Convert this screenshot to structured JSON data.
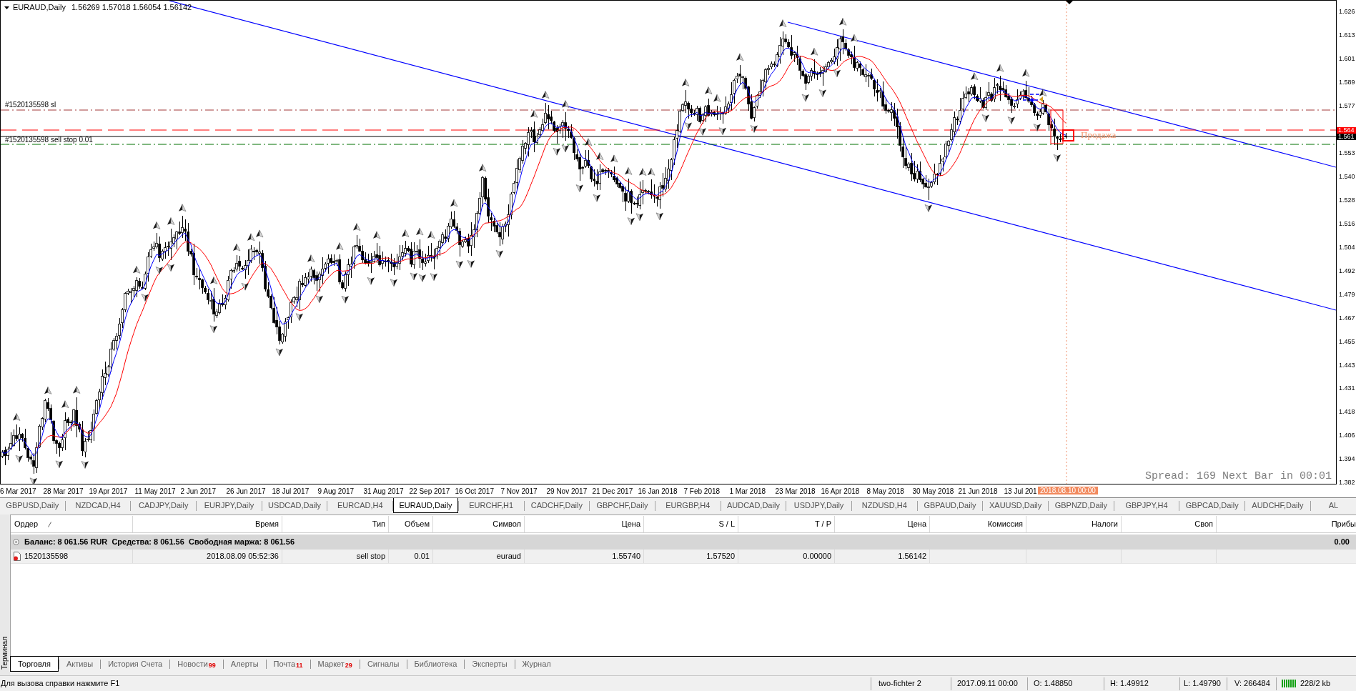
{
  "chart": {
    "header": {
      "symbol": "EURAUD,Daily",
      "ohlc": "1.56269 1.57018 1.56054 1.56142"
    },
    "stop_loss_label": "#1520135598 sl",
    "order_label": "#1520135598 sell stop 0.01",
    "signal_label": "Продажа",
    "info": "Spread: 169 Next Bar in 00:01",
    "price_axis": {
      "upper_labels": [
        "1.626",
        "1.613",
        "1.601",
        "1.589",
        "1.577"
      ],
      "markers": [
        {
          "text": "1.564",
          "color": "#ff0000"
        },
        {
          "text": "1.561",
          "color": "#000000"
        }
      ],
      "lower_labels": [
        "1.553",
        "1.540",
        "1.528",
        "1.516",
        "1.504",
        "1.492",
        "1.479",
        "1.467",
        "1.455",
        "1.443",
        "1.431",
        "1.418",
        "1.406",
        "1.394",
        "1.382"
      ]
    },
    "time_axis": {
      "labels": [
        "6 Mar 2017",
        "28 Mar 2017",
        "19 Apr 2017",
        "11 May 2017",
        "2 Jun 2017",
        "26 Jun 2017",
        "18 Jul 2017",
        "9 Aug 2017",
        "31 Aug 2017",
        "22 Sep 2017",
        "16 Oct 2017",
        "7 Nov 2017",
        "29 Nov 2017",
        "21 Dec 2017",
        "16 Jan 2018",
        "7 Feb 2018",
        "1 Mar 2018",
        "23 Mar 2018",
        "16 Apr 2018",
        "8 May 2018",
        "30 May 2018",
        "21 Jun 2018",
        "13 Jul 201"
      ],
      "cursor_label": "2018.08.10 00:00"
    }
  },
  "chart_tabs": [
    {
      "label": "GBPUSD,Daily",
      "selected": false
    },
    {
      "label": "NZDCAD,H4",
      "selected": false
    },
    {
      "label": "CADJPY,Daily",
      "selected": false
    },
    {
      "label": "EURJPY,Daily",
      "selected": false
    },
    {
      "label": "USDCAD,Daily",
      "selected": false
    },
    {
      "label": "EURCAD,H4",
      "selected": false
    },
    {
      "label": "EURAUD,Daily",
      "selected": true
    },
    {
      "label": "EURCHF,H1",
      "selected": false
    },
    {
      "label": "CADCHF,Daily",
      "selected": false
    },
    {
      "label": "GBPCHF,Daily",
      "selected": false
    },
    {
      "label": "EURGBP,H4",
      "selected": false
    },
    {
      "label": "AUDCAD,Daily",
      "selected": false
    },
    {
      "label": "USDJPY,Daily",
      "selected": false
    },
    {
      "label": "NZDUSD,H4",
      "selected": false
    },
    {
      "label": "GBPAUD,Daily",
      "selected": false
    },
    {
      "label": "XAUUSD,Daily",
      "selected": false
    },
    {
      "label": "GBPNZD,Daily",
      "selected": false
    },
    {
      "label": "GBPJPY,H4",
      "selected": false
    },
    {
      "label": "GBPCAD,Daily",
      "selected": false
    },
    {
      "label": "AUDCHF,Daily",
      "selected": false
    },
    {
      "label": "AL",
      "selected": false
    }
  ],
  "terminal": {
    "side_label": "Терминал",
    "columns": [
      "Ордер",
      "Время",
      "Тип",
      "Объем",
      "Символ",
      "Цена",
      "S / L",
      "T / P",
      "Цена",
      "Комиссия",
      "Налоги",
      "Своп",
      "Прибы"
    ],
    "balance": {
      "text": "Баланс: 8 061.56 RUR  Средства: 8 061.56  Свободная маржа: 8 061.56",
      "profit": "0.00"
    },
    "orders": [
      {
        "cells": [
          "1520135598",
          "2018.08.09 05:52:36",
          "sell stop",
          "0.01",
          "euraud",
          "1.55740",
          "1.57520",
          "0.00000",
          "1.56142"
        ]
      }
    ],
    "tabs": [
      {
        "label": "Торговля",
        "selected": true
      },
      {
        "label": "Активы",
        "selected": false
      },
      {
        "label": "История Счета",
        "selected": false
      },
      {
        "label": "Новости",
        "badge": "99",
        "selected": false
      },
      {
        "label": "Алерты",
        "selected": false
      },
      {
        "label": "Почта",
        "badge": "11",
        "selected": false
      },
      {
        "label": "Маркет",
        "badge": "29",
        "selected": false
      },
      {
        "label": "Сигналы",
        "selected": false
      },
      {
        "label": "Библиотека",
        "selected": false
      },
      {
        "label": "Эксперты",
        "selected": false
      },
      {
        "label": "Журнал",
        "selected": false
      }
    ]
  },
  "status_bar": {
    "help": "Для вызова справки нажмите F1",
    "profile": "two-fichter 2",
    "bar_time": "2017.09.11 00:00",
    "open": "O: 1.48850",
    "high": "H: 1.49912",
    "low": "L: 1.49790",
    "volume": "V: 266484",
    "traffic": "228/2 kb"
  }
}
